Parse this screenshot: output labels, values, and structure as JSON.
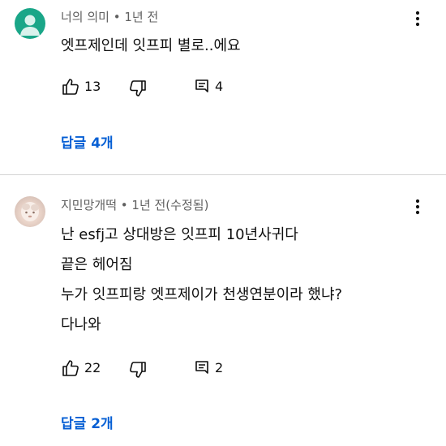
{
  "comments": [
    {
      "author": "너의 의미",
      "meta_suffix": " • 1년 전",
      "text_lines": [
        "엣프제인데 잇프피 별로..에요"
      ],
      "like_count": "13",
      "reply_count": "4",
      "replies_label": "답글 4개",
      "avatar_color": "#1aa688"
    },
    {
      "author": "지민망개떡",
      "meta_suffix": " • 1년 전(수정됨)",
      "text_lines": [
        "난 esfj고 상대방은 잇프피  10년사귀다",
        "끝은 헤어짐",
        "누가  잇프피랑 엣프제이가  천생연분이라 했냐?",
        "다나와"
      ],
      "like_count": "22",
      "reply_count": "2",
      "replies_label": "답글 2개"
    }
  ],
  "icons": {
    "like": "thumbs-up-icon",
    "dislike": "thumbs-down-icon",
    "reply": "comment-icon",
    "more": "more-vertical-icon"
  },
  "colors": {
    "link": "#065fd4",
    "meta": "#606060",
    "text": "#0f0f0f"
  }
}
